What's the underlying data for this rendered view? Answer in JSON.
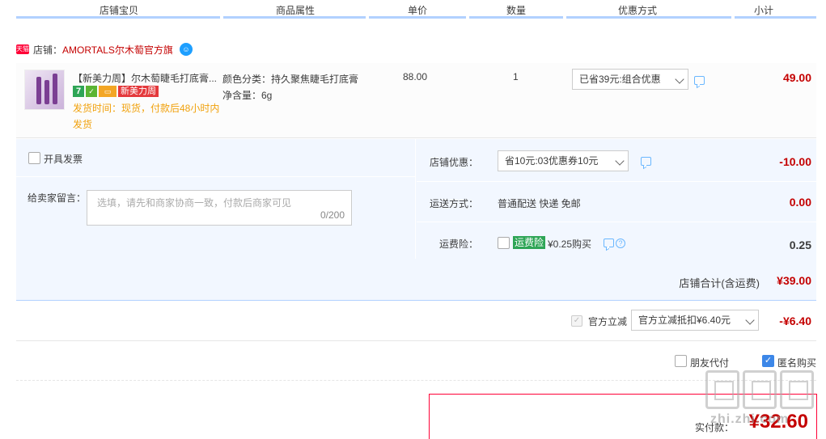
{
  "header": {
    "columns": [
      "店铺宝贝",
      "商品属性",
      "单价",
      "数量",
      "优惠方式",
      "小计"
    ]
  },
  "shop": {
    "badge": "天猫",
    "label": "店铺：",
    "name": "AMORTALS尔木萄官方旗"
  },
  "item": {
    "title": "【新美力周】尔木萄睫毛打底膏...",
    "badge_seven": "7",
    "badge_new": "新美力周",
    "ship_info": "发货时间：现货，付款后48小时内发货",
    "prop1": "颜色分类：持久聚焦睫毛打底膏",
    "prop2": "净含量：6g",
    "price": "88.00",
    "qty": "1",
    "promo": "已省39元:组合优惠",
    "subtotal": "49.00"
  },
  "invoice": {
    "label": "开具发票"
  },
  "remark": {
    "label": "给卖家留言：",
    "placeholder": "选填，请先和商家协商一致，付款后商家可见",
    "count": "0/200"
  },
  "shop_discount": {
    "label": "店铺优惠：",
    "select": "省10元:03优惠券10元",
    "value": "-10.00"
  },
  "shipping": {
    "label": "运送方式：",
    "method": "普通配送 快递 免邮",
    "value": "0.00"
  },
  "insurance": {
    "label": "运费险：",
    "tag": "运费险",
    "text": "¥0.25购买",
    "value": "0.25"
  },
  "shop_total": {
    "label": "店铺合计(含运费)",
    "value": "¥39.00"
  },
  "official": {
    "label": "官方立减",
    "select": "官方立减抵扣¥6.40元",
    "value": "-¥6.40"
  },
  "options": {
    "friend_pay": "朋友代付",
    "anonymous": "匿名购买"
  },
  "payment": {
    "label": "实付款：",
    "value": "¥32.60"
  },
  "watermark": {
    "text": "zhi.zhi.com"
  }
}
